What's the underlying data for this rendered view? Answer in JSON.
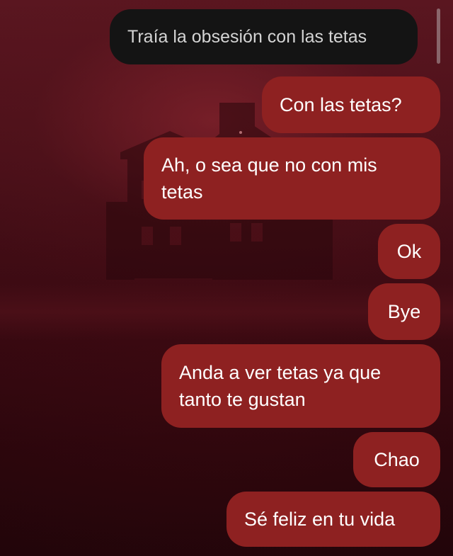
{
  "chat": {
    "incoming": [
      {
        "text": "Traía la obsesión con las tetas"
      }
    ],
    "outgoing": [
      {
        "text": "Con las tetas?"
      },
      {
        "text": "Ah, o sea que no con mis tetas"
      },
      {
        "text": "Ok"
      },
      {
        "text": "Bye"
      },
      {
        "text": "Anda a ver tetas ya que tanto te gustan"
      },
      {
        "text": "Chao"
      },
      {
        "text": "Sé feliz en tu vida"
      }
    ]
  },
  "colors": {
    "outgoing_bubble": "#8e2121",
    "incoming_bubble": "#141414",
    "background": "#3a0a0e"
  }
}
